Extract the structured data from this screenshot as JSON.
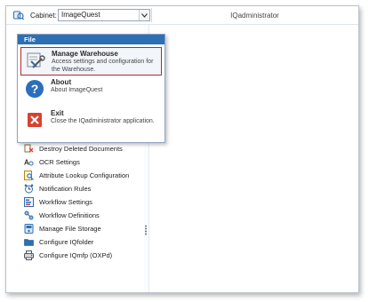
{
  "toolbar": {
    "cabinet_label": "Cabinet:",
    "cabinet_value": "ImageQuest",
    "window_title": "IQadministrator"
  },
  "file_menu": {
    "tab_label": "File",
    "items": [
      {
        "title": "Manage Warehouse",
        "description": "Access settings and configuration for the Warehouse.",
        "icon": "warehouse-tools-icon",
        "selected": true
      },
      {
        "title": "About",
        "description": "About ImageQuest",
        "icon": "help-icon"
      },
      {
        "title": "Exit",
        "description": "Close the IQadministrator application.",
        "icon": "close-x-icon"
      }
    ]
  },
  "sidebar": {
    "items": [
      {
        "label": "Destroy Deleted Documents",
        "icon": "destroy-documents-icon"
      },
      {
        "label": "OCR Settings",
        "icon": "ocr-icon"
      },
      {
        "label": "Attribute Lookup Configuration",
        "icon": "attribute-lookup-icon"
      },
      {
        "label": "Notification Rules",
        "icon": "alarm-clock-icon"
      },
      {
        "label": "Workflow Settings",
        "icon": "workflow-settings-icon"
      },
      {
        "label": "Workflow Definitions",
        "icon": "workflow-definitions-icon"
      },
      {
        "label": "Manage File Storage",
        "icon": "file-storage-icon"
      },
      {
        "label": "Configure IQfolder",
        "icon": "folder-icon"
      },
      {
        "label": "Configure IQmfp (OXPd)",
        "icon": "mfp-icon"
      }
    ]
  },
  "colors": {
    "file_tab": "#2c6fb3",
    "selection_border": "#b22b2b",
    "help_icon": "#2a6ebd",
    "exit_icon": "#d9412f"
  }
}
